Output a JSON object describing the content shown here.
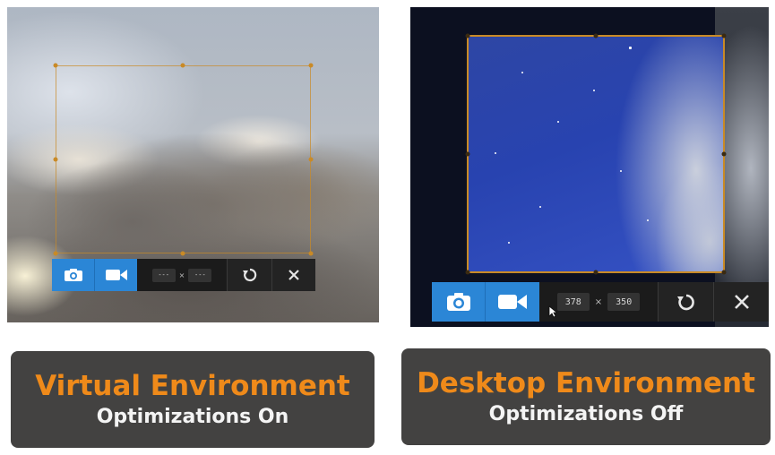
{
  "panels": [
    {
      "name": "virtual",
      "toolbar": {
        "width_value": "---",
        "height_value": "---",
        "separator": "×"
      },
      "caption": {
        "title": "Virtual Environment",
        "subtitle": "Optimizations On"
      }
    },
    {
      "name": "desktop",
      "toolbar": {
        "width_value": "378",
        "height_value": "350",
        "separator": "×"
      },
      "caption": {
        "title": "Desktop Environment",
        "subtitle": "Optimizations Off"
      }
    }
  ],
  "icons": {
    "screenshot": "camera-icon",
    "record": "video-camera-icon",
    "undo": "undo-icon",
    "close": "close-icon",
    "pointer": "cursor-icon"
  },
  "colors": {
    "accent_blue": "#2b86d6",
    "toolbar_bg": "#232323",
    "selection_border": "#c98a26",
    "caption_bg": "#434241",
    "caption_title": "#ef8a1a",
    "caption_subtitle": "#f4f4f4"
  }
}
